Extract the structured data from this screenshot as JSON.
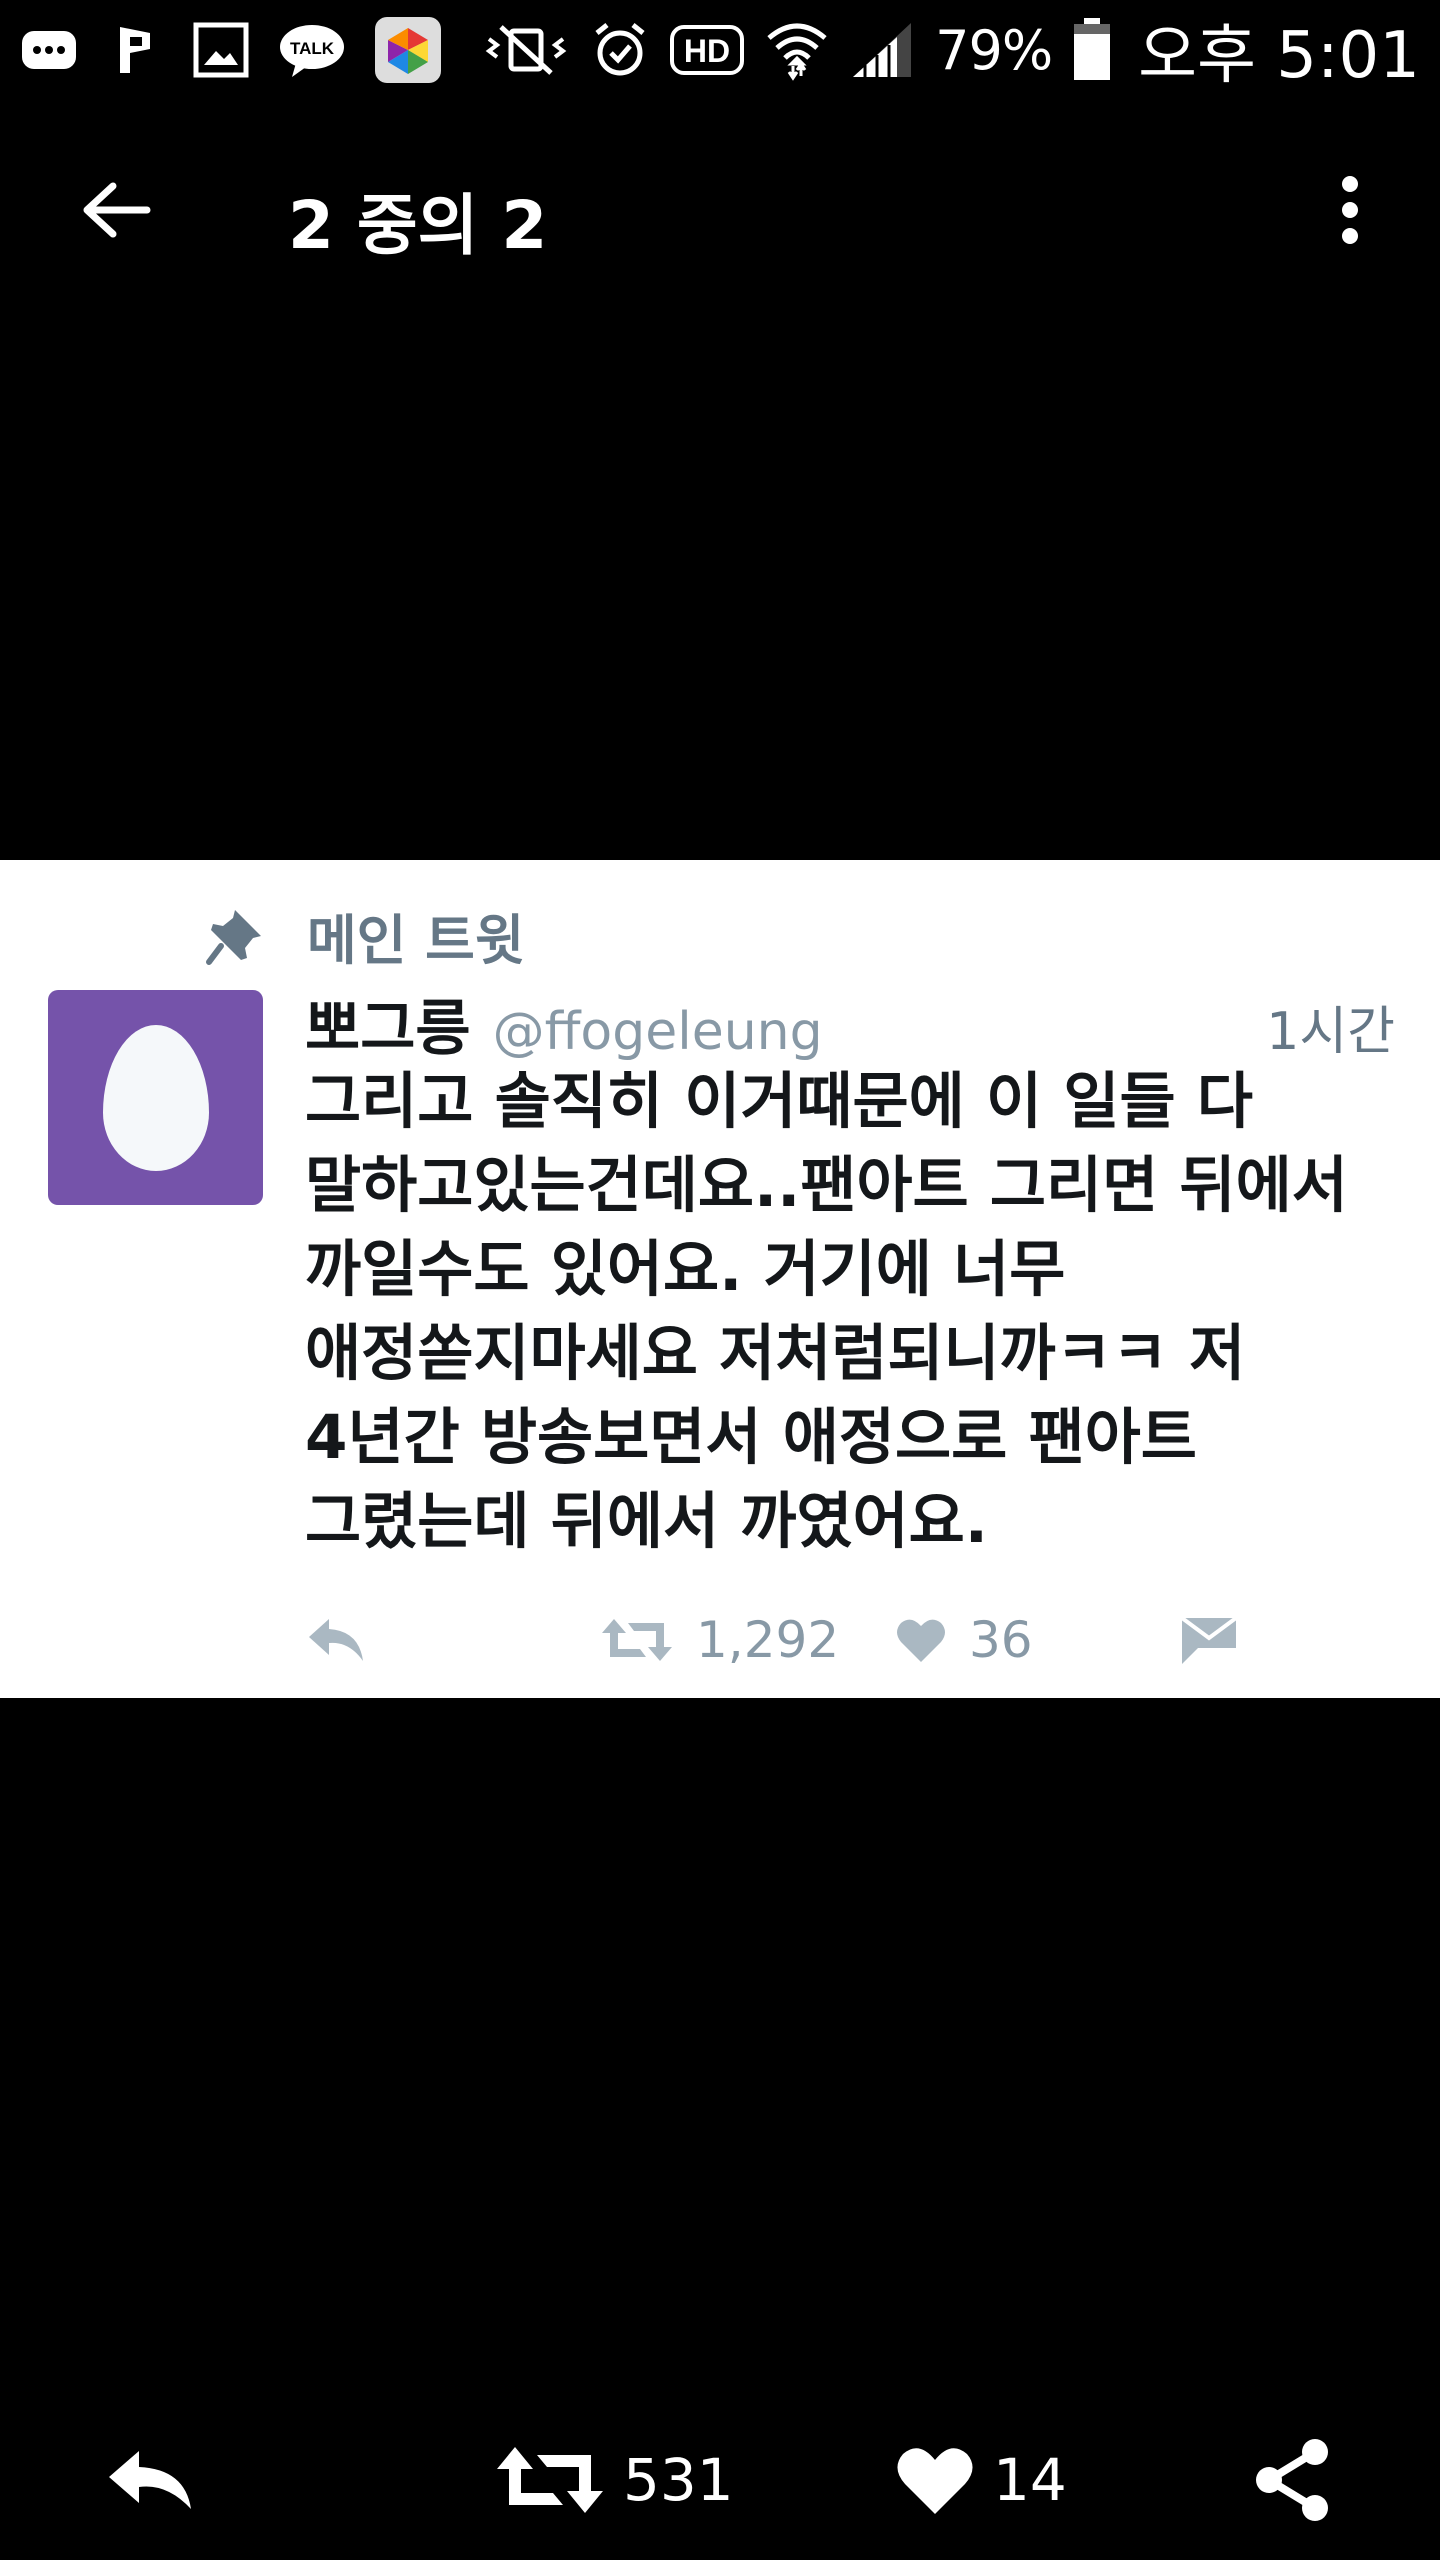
{
  "status_bar": {
    "left_icons": [
      "message-icon",
      "p-app-icon",
      "gallery-icon",
      "kakaotalk-icon",
      "app-icon"
    ],
    "talk_label": "TALK",
    "right_icons": [
      "vibrate-mute-icon",
      "alarm-icon",
      "hd-icon",
      "wifi-icon",
      "signal-icon",
      "battery-icon"
    ],
    "hd_label": "HD",
    "battery": "79%",
    "time": "오후 5:01"
  },
  "app_bar": {
    "title": "2 중의 2"
  },
  "tweet": {
    "pinned_label": "메인 트윗",
    "display_name": "뽀그릉",
    "handle": "@ffogeleung",
    "timestamp": "1시간",
    "text_lines": [
      "그리고 솔직히 이거때문에 이 일들 다",
      "말하고있는건데요..팬아트 그리면 뒤에서",
      "까일수도 있어요. 거기에 너무",
      "애정쏟지마세요 저처럼되니까ㅋㅋ 저",
      "4년간 방송보면서 애정으로 팬아트",
      "그렸는데 뒤에서 까였어요."
    ],
    "retweets": "1,292",
    "likes": "36"
  },
  "bottom_bar": {
    "retweets": "531",
    "likes": "14"
  },
  "colors": {
    "background": "#000000",
    "card": "#ffffff",
    "avatar": "#7553aa",
    "muted": "#8899a6"
  }
}
